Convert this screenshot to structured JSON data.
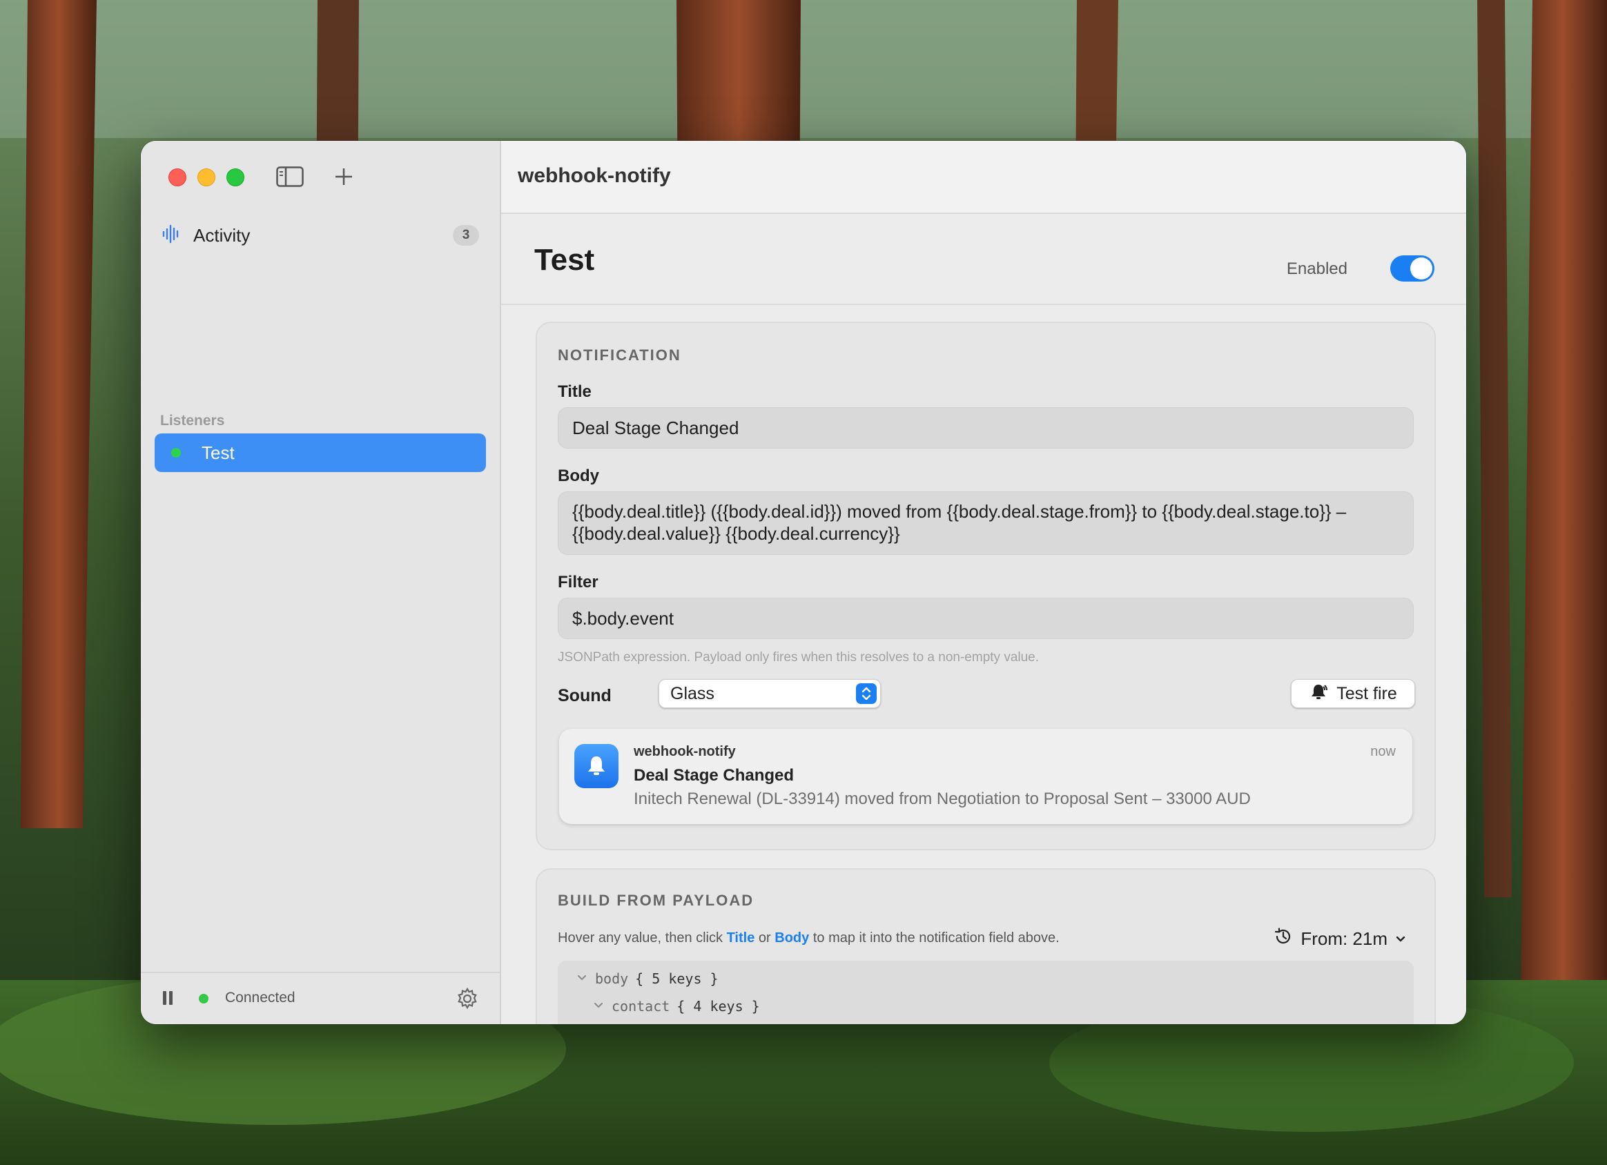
{
  "app": {
    "name": "webhook-notify"
  },
  "sidebar": {
    "activity": {
      "label": "Activity",
      "count": "3",
      "icon": "waveform-icon"
    },
    "section_label": "Listeners",
    "listeners": [
      {
        "label": "Test",
        "status": "active",
        "selected": true
      }
    ],
    "footer": {
      "status": "Connected",
      "status_color": "#34c748"
    }
  },
  "header": {
    "title": "Test",
    "enabled_label": "Enabled",
    "enabled": true
  },
  "notification": {
    "heading": "NOTIFICATION",
    "title_label": "Title",
    "title_value": "Deal Stage Changed",
    "body_label": "Body",
    "body_value": "{{body.deal.title}} ({{body.deal.id}}) moved from {{body.deal.stage.from}} to {{body.deal.stage.to}} – {{body.deal.value}} {{body.deal.currency}}",
    "filter_label": "Filter",
    "filter_value": "$.body.event",
    "filter_hint": "JSONPath expression. Payload only fires when this resolves to a non-empty value.",
    "sound_label": "Sound",
    "sound_value": "Glass",
    "test_fire_label": "Test fire",
    "preview": {
      "app": "webhook-notify",
      "time": "now",
      "title": "Deal Stage Changed",
      "body": "Initech Renewal (DL-33914) moved from Negotiation to Proposal Sent – 33000 AUD"
    }
  },
  "build": {
    "heading": "BUILD FROM PAYLOAD",
    "desc_prefix": "Hover any value, then click",
    "desc_title": "Title",
    "desc_or": "or",
    "desc_body": "Body",
    "desc_suffix": "to map it into the notification field above.",
    "from_label": "From: 21m",
    "tree": [
      {
        "key": "body",
        "summary": "{ 5 keys }"
      },
      {
        "key": "contact",
        "summary": "{ 4 keys }"
      }
    ]
  },
  "colors": {
    "accent": "#1a7ff2",
    "selection": "#3d8ff5"
  }
}
